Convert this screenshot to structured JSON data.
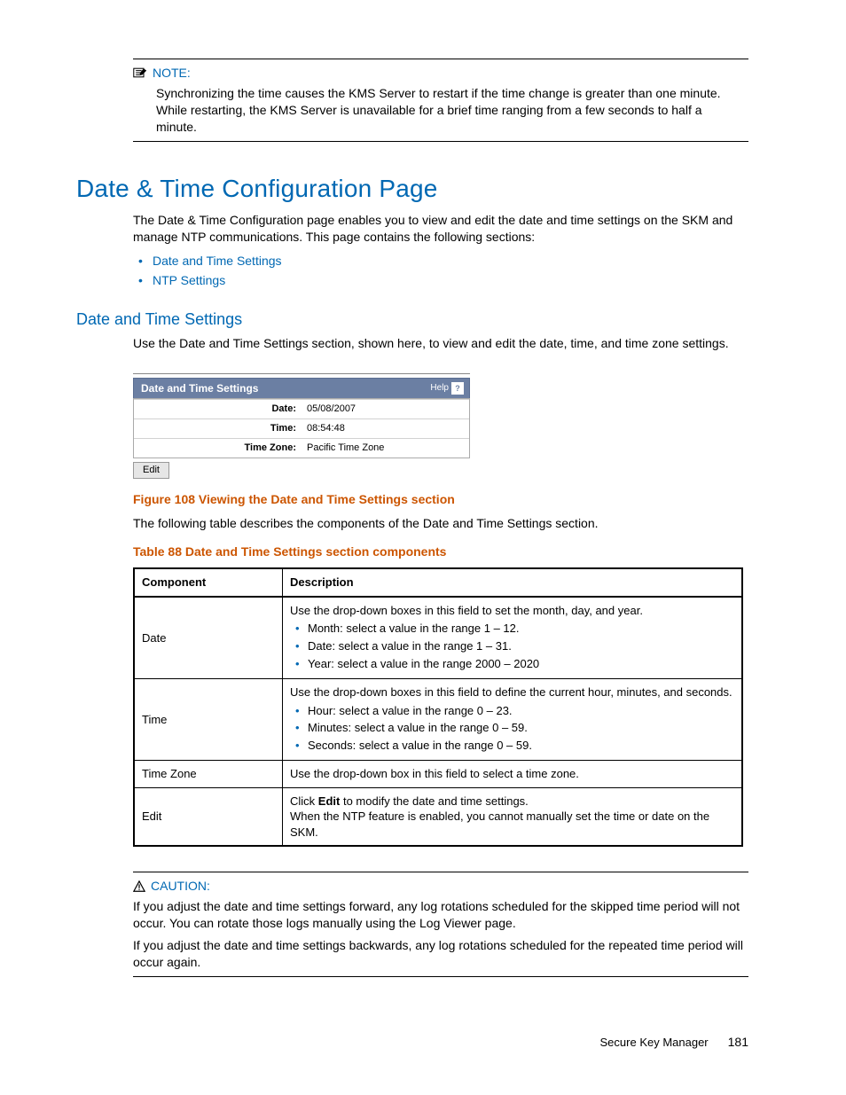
{
  "note": {
    "label": "NOTE:",
    "body": "Synchronizing the time causes the KMS Server to restart if the time change is greater than one minute. While restarting, the KMS Server is unavailable for a brief time ranging from a few seconds to half a minute."
  },
  "section": {
    "title": "Date & Time Configuration Page",
    "intro": "The Date & Time Configuration page enables you to view and edit the date and time settings on the SKM and manage NTP communications. This page contains the following sections:",
    "links": [
      "Date and Time Settings",
      "NTP Settings"
    ]
  },
  "subsection": {
    "title": "Date and Time Settings",
    "para": "Use the Date and Time Settings section, shown here, to view and edit the date, time, and time zone settings."
  },
  "panel": {
    "title": "Date and Time Settings",
    "help": "Help",
    "rows": [
      {
        "k": "Date:",
        "v": "05/08/2007"
      },
      {
        "k": "Time:",
        "v": "08:54:48"
      },
      {
        "k": "Time Zone:",
        "v": "Pacific Time Zone"
      }
    ],
    "edit": "Edit"
  },
  "figure_caption": "Figure 108 Viewing the Date and Time Settings section",
  "after_figure": "The following table describes the components of the Date and Time Settings section.",
  "table_caption": "Table 88 Date and Time Settings section components",
  "table": {
    "headers": [
      "Component",
      "Description"
    ],
    "rows": [
      {
        "name": "Date",
        "lead": "Use the drop-down boxes in this field to set the month, day, and year.",
        "bullets": [
          "Month: select a value in the range 1 – 12.",
          "Date: select a value in the range 1 – 31.",
          "Year: select a value in the range 2000 – 2020"
        ]
      },
      {
        "name": "Time",
        "lead": "Use the drop-down boxes in this field to define the current hour, minutes, and seconds.",
        "bullets": [
          "Hour: select a value in the range 0 – 23.",
          "Minutes: select a value in the range 0 – 59.",
          "Seconds: select a value in the range 0 – 59."
        ]
      },
      {
        "name": "Time Zone",
        "lead": "Use the drop-down box in this field to select a time zone.",
        "bullets": []
      },
      {
        "name": "Edit",
        "lead_rich": {
          "pre": "Click ",
          "bold": "Edit",
          "post": " to modify the date and time settings."
        },
        "extra": "When the NTP feature is enabled, you cannot manually set the time or date on the SKM.",
        "bullets": []
      }
    ]
  },
  "caution": {
    "label": "CAUTION:",
    "p1": "If you adjust the date and time settings forward, any log rotations scheduled for the skipped time period will not occur. You can rotate those logs manually using the Log Viewer page.",
    "p2": "If you adjust the date and time settings backwards, any log rotations scheduled for the repeated time period will occur again."
  },
  "footer": {
    "doc": "Secure Key Manager",
    "page": "181"
  }
}
